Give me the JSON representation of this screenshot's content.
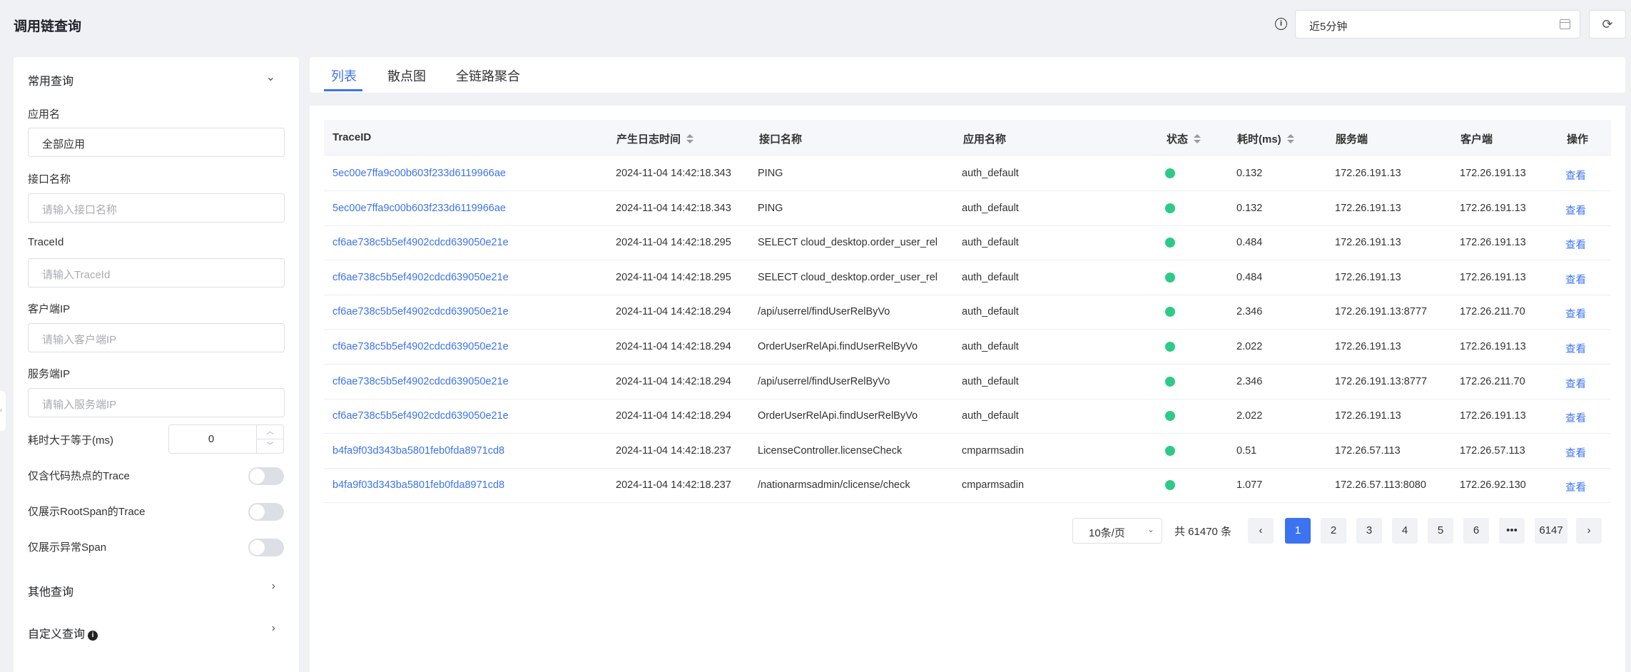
{
  "header": {
    "title": "调用链查询",
    "time_range": "近5分钟"
  },
  "sidebar": {
    "common_query": "常用查询",
    "app_name_label": "应用名",
    "app_name_value": "全部应用",
    "api_label": "接口名称",
    "api_placeholder": "请输入接口名称",
    "traceid_label": "TraceId",
    "traceid_placeholder": "请输入TraceId",
    "client_ip_label": "客户端IP",
    "client_ip_placeholder": "请输入客户端IP",
    "server_ip_label": "服务端IP",
    "server_ip_placeholder": "请输入服务端IP",
    "duration_label": "耗时大于等于(ms)",
    "duration_value": "0",
    "toggle1_label": "仅含代码热点的Trace",
    "toggle2_label": "仅展示RootSpan的Trace",
    "toggle3_label": "仅展示异常Span",
    "other_query": "其他查询",
    "custom_query": "自定义查询"
  },
  "tabs": [
    {
      "label": "列表",
      "active": true
    },
    {
      "label": "散点图",
      "active": false
    },
    {
      "label": "全链路聚合",
      "active": false
    }
  ],
  "table": {
    "columns": [
      "TraceID",
      "产生日志时间",
      "接口名称",
      "应用名称",
      "状态",
      "耗时(ms)",
      "服务端",
      "客户端",
      "操作"
    ],
    "status_color": "#2ecb86",
    "rows": [
      {
        "traceid": "5ec00e7ffa9c00b603f233d6119966ae",
        "time": "2024-11-04 14:42:18.343",
        "api": "PING",
        "app": "auth_default",
        "duration": "0.132",
        "server": "172.26.191.13",
        "client": "172.26.191.13",
        "action": "查看"
      },
      {
        "traceid": "5ec00e7ffa9c00b603f233d6119966ae",
        "time": "2024-11-04 14:42:18.343",
        "api": "PING",
        "app": "auth_default",
        "duration": "0.132",
        "server": "172.26.191.13",
        "client": "172.26.191.13",
        "action": "查看"
      },
      {
        "traceid": "cf6ae738c5b5ef4902cdcd639050e21e",
        "time": "2024-11-04 14:42:18.295",
        "api": "SELECT cloud_desktop.order_user_rel",
        "app": "auth_default",
        "duration": "0.484",
        "server": "172.26.191.13",
        "client": "172.26.191.13",
        "action": "查看"
      },
      {
        "traceid": "cf6ae738c5b5ef4902cdcd639050e21e",
        "time": "2024-11-04 14:42:18.295",
        "api": "SELECT cloud_desktop.order_user_rel",
        "app": "auth_default",
        "duration": "0.484",
        "server": "172.26.191.13",
        "client": "172.26.191.13",
        "action": "查看"
      },
      {
        "traceid": "cf6ae738c5b5ef4902cdcd639050e21e",
        "time": "2024-11-04 14:42:18.294",
        "api": "/api/userrel/findUserRelByVo",
        "app": "auth_default",
        "duration": "2.346",
        "server": "172.26.191.13:8777",
        "client": "172.26.211.70",
        "action": "查看"
      },
      {
        "traceid": "cf6ae738c5b5ef4902cdcd639050e21e",
        "time": "2024-11-04 14:42:18.294",
        "api": "OrderUserRelApi.findUserRelByVo",
        "app": "auth_default",
        "duration": "2.022",
        "server": "172.26.191.13",
        "client": "172.26.191.13",
        "action": "查看"
      },
      {
        "traceid": "cf6ae738c5b5ef4902cdcd639050e21e",
        "time": "2024-11-04 14:42:18.294",
        "api": "/api/userrel/findUserRelByVo",
        "app": "auth_default",
        "duration": "2.346",
        "server": "172.26.191.13:8777",
        "client": "172.26.211.70",
        "action": "查看"
      },
      {
        "traceid": "cf6ae738c5b5ef4902cdcd639050e21e",
        "time": "2024-11-04 14:42:18.294",
        "api": "OrderUserRelApi.findUserRelByVo",
        "app": "auth_default",
        "duration": "2.022",
        "server": "172.26.191.13",
        "client": "172.26.191.13",
        "action": "查看"
      },
      {
        "traceid": "b4fa9f03d343ba5801feb0fda8971cd8",
        "time": "2024-11-04 14:42:18.237",
        "api": "LicenseController.licenseCheck",
        "app": "cmparmsadin",
        "duration": "0.51",
        "server": "172.26.57.113",
        "client": "172.26.57.113",
        "action": "查看"
      },
      {
        "traceid": "b4fa9f03d343ba5801feb0fda8971cd8",
        "time": "2024-11-04 14:42:18.237",
        "api": "/nationarmsadmin/clicense/check",
        "app": "cmparmsadin",
        "duration": "1.077",
        "server": "172.26.57.113:8080",
        "client": "172.26.92.130",
        "action": "查看"
      }
    ]
  },
  "pagination": {
    "page_size": "10条/页",
    "total": "共 61470 条",
    "pages": [
      "1",
      "2",
      "3",
      "4",
      "5",
      "6",
      "•••",
      "6147"
    ],
    "prev": "‹",
    "next": "›"
  }
}
